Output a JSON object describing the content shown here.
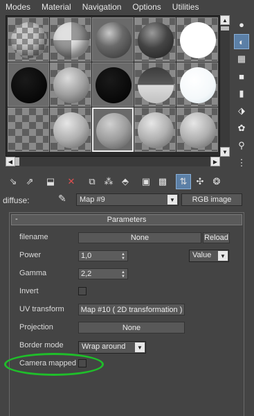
{
  "menu": [
    "Modes",
    "Material",
    "Navigation",
    "Options",
    "Utilities"
  ],
  "slots": [
    {
      "style": "checker",
      "sphere": "checker",
      "active": false
    },
    {
      "style": "checker",
      "sphere": "bigchecker",
      "active": false
    },
    {
      "style": "dark-bg",
      "sphere": "darkgrey",
      "active": false
    },
    {
      "style": "checker",
      "sphere": "dark",
      "active": false
    },
    {
      "style": "checker",
      "sphere": "white",
      "active": false
    },
    {
      "style": "dark-bg",
      "sphere": "black",
      "active": false
    },
    {
      "style": "checker",
      "sphere": "speckle",
      "active": false
    },
    {
      "style": "dark-bg",
      "sphere": "black",
      "active": false
    },
    {
      "style": "checker",
      "sphere": "split",
      "active": false
    },
    {
      "style": "checker",
      "sphere": "whiteblue",
      "active": false
    },
    {
      "style": "checker",
      "sphere": "none",
      "active": false
    },
    {
      "style": "checker",
      "sphere": "grey",
      "active": false
    },
    {
      "style": "dark-bg",
      "sphere": "grey2",
      "active": true
    },
    {
      "style": "checker",
      "sphere": "grey",
      "active": false
    },
    {
      "style": "checker",
      "sphere": "grey",
      "active": false
    }
  ],
  "right_tools": [
    {
      "name": "sample-type-icon",
      "glyph": "●",
      "pressed": false
    },
    {
      "name": "backlight-icon",
      "glyph": "◐",
      "pressed": true
    },
    {
      "name": "background-icon",
      "glyph": "▦",
      "pressed": false
    },
    {
      "name": "sample-uv-tiling-icon",
      "glyph": "■",
      "pressed": false
    },
    {
      "name": "video-color-check-icon",
      "glyph": "▮",
      "pressed": false
    },
    {
      "name": "make-preview-icon",
      "glyph": "⬗",
      "pressed": false
    },
    {
      "name": "options-icon",
      "glyph": "✿",
      "pressed": false
    },
    {
      "name": "select-by-material-icon",
      "glyph": "⚲",
      "pressed": false
    },
    {
      "name": "material-map-navigator-icon",
      "glyph": "⋮",
      "pressed": false
    }
  ],
  "toolbar": [
    {
      "name": "get-material-icon",
      "glyph": "⇘"
    },
    {
      "name": "put-material-icon",
      "glyph": "⇗"
    },
    {
      "name": "assign-material-icon",
      "glyph": "⬓"
    },
    {
      "name": "delete-icon",
      "glyph": "✕"
    },
    {
      "name": "copy-material-icon",
      "glyph": "⧉"
    },
    {
      "name": "make-unique-icon",
      "glyph": "⁂"
    },
    {
      "name": "put-to-library-icon",
      "glyph": "⬘"
    },
    {
      "name": "material-id-icon",
      "glyph": "▣"
    },
    {
      "name": "show-map-in-viewport-icon",
      "glyph": "▩"
    },
    {
      "name": "show-end-result-icon",
      "glyph": "⇅"
    },
    {
      "name": "go-to-parent-icon",
      "glyph": "✣"
    },
    {
      "name": "go-forward-icon",
      "glyph": "❂"
    }
  ],
  "diffuse": {
    "label": "diffuse:",
    "map_name": "Map #9",
    "map_type": "RGB image"
  },
  "rollout": {
    "collapse": "-",
    "title": "Parameters"
  },
  "params": {
    "filename_label": "filename",
    "filename_value": "None",
    "reload_label": "Reload",
    "power_label": "Power",
    "power_value": "1,0",
    "power_mode": "Value",
    "gamma_label": "Gamma",
    "gamma_value": "2,2",
    "invert_label": "Invert",
    "uv_label": "UV transform",
    "uv_value": "Map #10  ( 2D transformation )",
    "projection_label": "Projection",
    "projection_value": "None",
    "border_label": "Border mode",
    "border_value": "Wrap around",
    "camera_label": "Camera mapped"
  },
  "colors": {
    "highlight": "#1fbf2a",
    "pressed": "#5b7fa6"
  }
}
